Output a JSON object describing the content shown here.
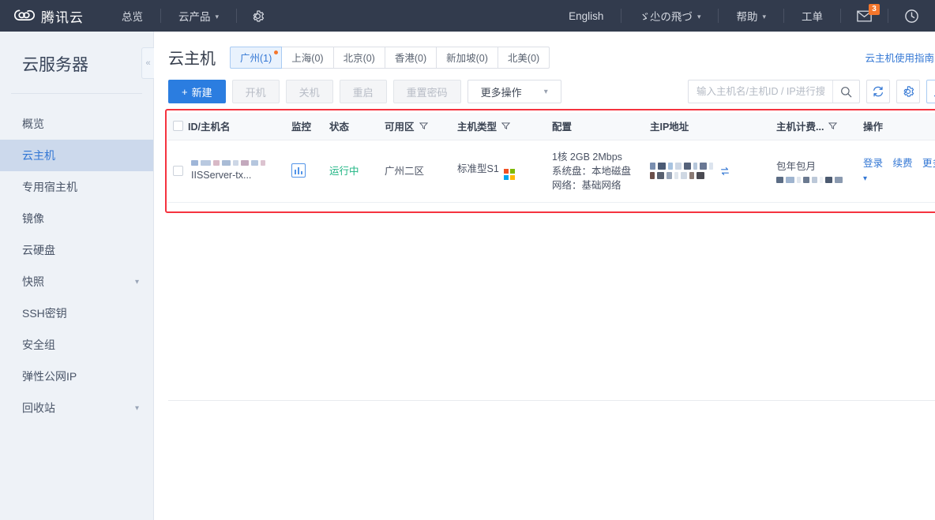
{
  "topbar": {
    "brand_name": "腾讯云",
    "brand_icon": "cloud-logo-icon",
    "nav": [
      {
        "label": "总览",
        "has_caret": false
      },
      {
        "label": "云产品",
        "has_caret": true
      }
    ],
    "gear_icon": "gear-icon",
    "right_items": [
      {
        "label": "English",
        "has_caret": false
      },
      {
        "label": "ゞ尐の飛づ",
        "has_caret": true
      },
      {
        "label": "帮助",
        "has_caret": true
      },
      {
        "label": "工单",
        "has_caret": false
      }
    ],
    "mail_icon": "mail-icon",
    "mail_badge": "3",
    "history_icon": "history-clock-icon",
    "bg_color": "#323b4d",
    "badge_color": "#f5762b"
  },
  "sidebar": {
    "title": "云服务器",
    "collapse_icon": "chevron-double-left-icon",
    "items": [
      {
        "label": "概览",
        "active": false,
        "expandable": false
      },
      {
        "label": "云主机",
        "active": true,
        "expandable": false
      },
      {
        "label": "专用宿主机",
        "active": false,
        "expandable": false
      },
      {
        "label": "镜像",
        "active": false,
        "expandable": false
      },
      {
        "label": "云硬盘",
        "active": false,
        "expandable": false
      },
      {
        "label": "快照",
        "active": false,
        "expandable": true
      },
      {
        "label": "SSH密钥",
        "active": false,
        "expandable": false
      },
      {
        "label": "安全组",
        "active": false,
        "expandable": false
      },
      {
        "label": "弹性公网IP",
        "active": false,
        "expandable": false
      },
      {
        "label": "回收站",
        "active": false,
        "expandable": true
      }
    ],
    "active_color": "#3377d4"
  },
  "page": {
    "title": "云主机",
    "guide_link": "云主机使用指南",
    "guide_icon": "external-link-icon",
    "regions": [
      {
        "label": "广州(1)",
        "active": true,
        "dot": true
      },
      {
        "label": "上海(0)",
        "active": false,
        "dot": false
      },
      {
        "label": "北京(0)",
        "active": false,
        "dot": false
      },
      {
        "label": "香港(0)",
        "active": false,
        "dot": false
      },
      {
        "label": "新加坡(0)",
        "active": false,
        "dot": false
      },
      {
        "label": "北美(0)",
        "active": false,
        "dot": false
      }
    ]
  },
  "toolbar": {
    "create_label": "新建",
    "create_icon": "plus-icon",
    "buttons": [
      {
        "label": "开机",
        "disabled": true
      },
      {
        "label": "关机",
        "disabled": true
      },
      {
        "label": "重启",
        "disabled": true
      },
      {
        "label": "重置密码",
        "disabled": true
      }
    ],
    "more_ops_label": "更多操作",
    "more_ops_icon": "chevron-down-icon",
    "search_placeholder": "输入主机名/主机ID / IP进行搜索",
    "search_value": "",
    "search_icon": "search-icon",
    "refresh_icon": "refresh-icon",
    "settings_icon": "gear-icon",
    "export_icon": "download-icon",
    "primary_color": "#2b7de0"
  },
  "table": {
    "columns": [
      {
        "label": "ID/主机名",
        "filter": false
      },
      {
        "label": "监控",
        "filter": false
      },
      {
        "label": "状态",
        "filter": false
      },
      {
        "label": "可用区",
        "filter": true
      },
      {
        "label": "主机类型",
        "filter": true
      },
      {
        "label": "配置",
        "filter": false
      },
      {
        "label": "主IP地址",
        "filter": false
      },
      {
        "label": "主机计费...",
        "filter": true
      },
      {
        "label": "操作",
        "filter": false
      }
    ],
    "rows": [
      {
        "id_redacted": true,
        "host_name": "IISServer-tx...",
        "monitor_icon": "bar-chart-icon",
        "status": "运行中",
        "status_color": "#1db482",
        "zone": "广州二区",
        "host_type": "标准型S1",
        "os_icon": "windows-logo-icon",
        "config_line1": "1核 2GB 2Mbps",
        "config_line2": "系统盘：本地磁盘",
        "config_line3": "网络：基础网络",
        "ip_redacted": true,
        "ip_copy_icon": "switch-ip-icon",
        "billing_mode": "包年包月",
        "billing_date_redacted": true,
        "actions": [
          "登录",
          "续费"
        ],
        "more_label": "更多",
        "more_icon": "chevron-down-icon"
      }
    ],
    "highlight_color": "#f5333f"
  }
}
